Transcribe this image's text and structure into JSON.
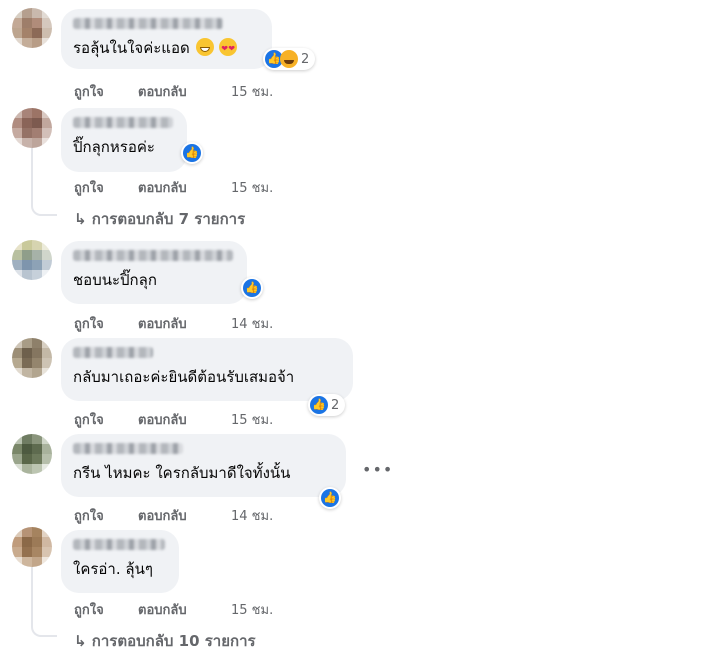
{
  "comments": [
    {
      "text": "รอลุ้นในใจค่ะแอด",
      "like": "ถูกใจ",
      "reply": "ตอบกลับ",
      "time": "15 ชม.",
      "reaction_count": "2"
    },
    {
      "text": "ปิ๊กลุกหรอค่ะ",
      "like": "ถูกใจ",
      "reply": "ตอบกลับ",
      "time": "15 ชม.",
      "replies": "การตอบกลับ 7 รายการ"
    },
    {
      "text": "ชอบนะปิ๊กลุก",
      "like": "ถูกใจ",
      "reply": "ตอบกลับ",
      "time": "14 ชม."
    },
    {
      "text": "กลับมาเถอะค่ะยินดีต้อนรับเสมอจ้า",
      "like": "ถูกใจ",
      "reply": "ตอบกลับ",
      "time": "15 ชม.",
      "reaction_count": "2"
    },
    {
      "text": "กรีน ไหมคะ ใครกลับมาดีใจทั้งนั้น",
      "like": "ถูกใจ",
      "reply": "ตอบกลับ",
      "time": "14 ชม."
    },
    {
      "text": "ใครอ่า. ลุ้นๆ",
      "like": "ถูกใจ",
      "reply": "ตอบกลับ",
      "time": "15 ชม.",
      "replies": "การตอบกลับ 10 รายการ"
    }
  ],
  "icons": {
    "like": "like-reaction-icon",
    "haha": "sad-reaction-icon",
    "more": "more-options-icon",
    "reply_arrow": "reply-arrow-icon"
  },
  "colors": {
    "bubble": "#f0f2f5",
    "meta": "#65676b",
    "like_blue": "#1b74e4"
  }
}
